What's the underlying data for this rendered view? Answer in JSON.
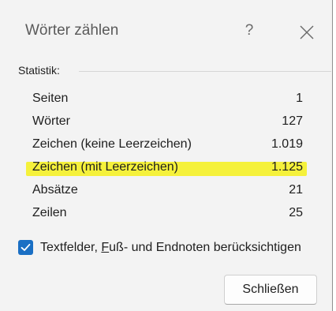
{
  "dialog": {
    "title": "Wörter zählen",
    "help_label": "?",
    "close_icon": "close-icon"
  },
  "statistics": {
    "group_label": "Statistik:",
    "rows": [
      {
        "label": "Seiten",
        "value": "1",
        "highlighted": false
      },
      {
        "label": "Wörter",
        "value": "127",
        "highlighted": false
      },
      {
        "label": "Zeichen (keine Leerzeichen)",
        "value": "1.019",
        "highlighted": false
      },
      {
        "label": "Zeichen (mit Leerzeichen)",
        "value": "1.125",
        "highlighted": true
      },
      {
        "label": "Absätze",
        "value": "21",
        "highlighted": false
      },
      {
        "label": "Zeilen",
        "value": "25",
        "highlighted": false
      }
    ],
    "highlight_color": "#f4f01a"
  },
  "options": {
    "include_textboxes": {
      "checked": true,
      "label_part1": "Textfelder, ",
      "label_underlined": "F",
      "label_part2": "uß- und Endnoten berücksichtigen",
      "check_color": "#1a6fc4"
    }
  },
  "buttons": {
    "close_label": "Schließen"
  }
}
